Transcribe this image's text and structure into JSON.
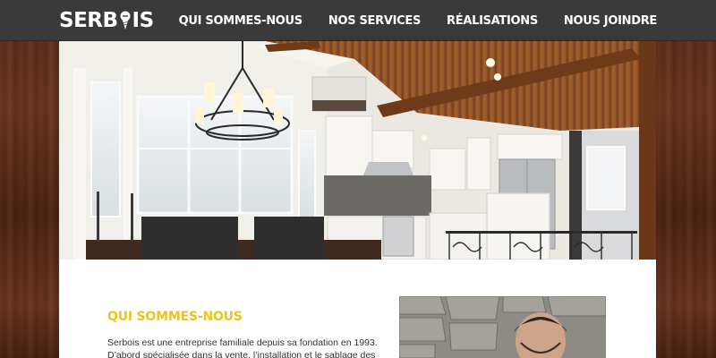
{
  "brand": {
    "logo_text_left": "SERB",
    "logo_text_right": "IS"
  },
  "nav": {
    "items": [
      {
        "label": "QUI SOMMES-NOUS"
      },
      {
        "label": "NOS SERVICES"
      },
      {
        "label": "RÉALISATIONS"
      },
      {
        "label": "NOUS JOINDRE"
      }
    ]
  },
  "about": {
    "title": "QUI SOMMES-NOUS",
    "text": "Serbois est une entreprise familiale depuis sa fondation en 1993. D’abord spécialisée dans la vente, l’installation et le sablage des planchers de bois,"
  },
  "colors": {
    "header_bg": "#3a3a3a",
    "accent": "#f2c21a",
    "wood": "#5a2c18"
  }
}
